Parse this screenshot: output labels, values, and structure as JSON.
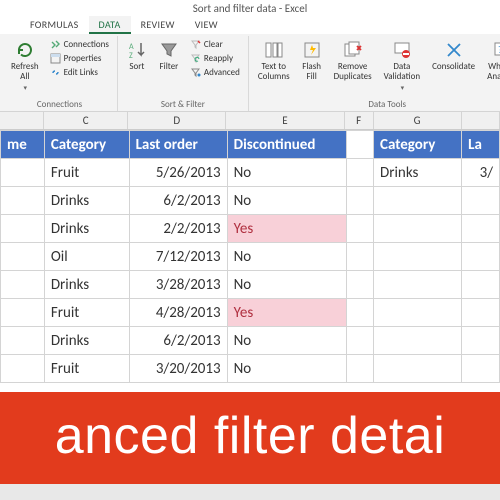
{
  "window": {
    "title": "Sort and filter data - Excel"
  },
  "tabs": {
    "formulas": "FORMULAS",
    "data": "DATA",
    "review": "REVIEW",
    "view": "VIEW"
  },
  "ribbon": {
    "refresh": "Refresh\nAll",
    "connections": "Connections",
    "properties": "Properties",
    "editlinks": "Edit Links",
    "group_connections": "Connections",
    "sort": "Sort",
    "filter": "Filter",
    "clear": "Clear",
    "reapply": "Reapply",
    "advanced": "Advanced",
    "group_sortfilter": "Sort & Filter",
    "texttocols": "Text to\nColumns",
    "flashfill": "Flash\nFill",
    "removedup": "Remove\nDuplicates",
    "datavalid": "Data\nValidation",
    "consolidate": "Consolidate",
    "whatif": "What-If\nAnalysis",
    "group_datatools": "Data Tools"
  },
  "colheads": {
    "C": "C",
    "D": "D",
    "E": "E",
    "F": "F",
    "G": "G"
  },
  "table1": {
    "headers": {
      "name": "me",
      "category": "Category",
      "lastorder": "Last order",
      "disc": "Discontinued"
    },
    "rows": [
      {
        "category": "Fruit",
        "lastorder": "5/26/2013",
        "disc": "No",
        "pink": false
      },
      {
        "category": "Drinks",
        "lastorder": "6/2/2013",
        "disc": "No",
        "pink": false
      },
      {
        "category": "Drinks",
        "lastorder": "2/2/2013",
        "disc": "Yes",
        "pink": true
      },
      {
        "category": "Oil",
        "lastorder": "7/12/2013",
        "disc": "No",
        "pink": false
      },
      {
        "category": "Drinks",
        "lastorder": "3/28/2013",
        "disc": "No",
        "pink": false
      },
      {
        "category": "Fruit",
        "lastorder": "4/28/2013",
        "disc": "Yes",
        "pink": true
      },
      {
        "category": "Drinks",
        "lastorder": "6/2/2013",
        "disc": "No",
        "pink": false
      },
      {
        "category": "Fruit",
        "lastorder": "3/20/2013",
        "disc": "No",
        "pink": false
      }
    ]
  },
  "table2": {
    "headers": {
      "category": "Category",
      "last": "La"
    },
    "rows": [
      {
        "category": "Drinks",
        "last": "3/"
      }
    ]
  },
  "banner": "anced filter detai"
}
